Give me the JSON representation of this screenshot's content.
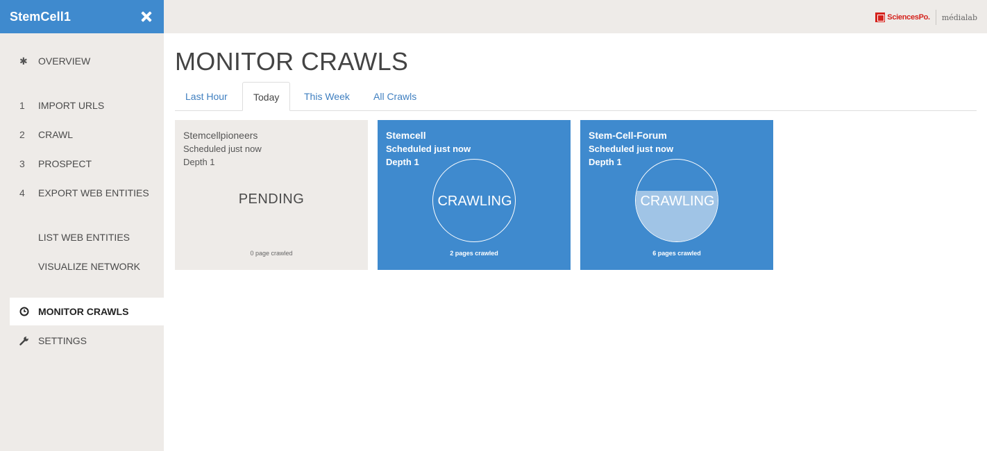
{
  "app": {
    "title": "StemCell1"
  },
  "sidebar": {
    "items": [
      {
        "lead": "✱",
        "label": "OVERVIEW"
      },
      {
        "lead": "1",
        "label": "IMPORT URLS"
      },
      {
        "lead": "2",
        "label": "CRAWL"
      },
      {
        "lead": "3",
        "label": "PROSPECT"
      },
      {
        "lead": "4",
        "label": "EXPORT WEB ENTITIES"
      },
      {
        "lead": "",
        "label": "LIST WEB ENTITIES"
      },
      {
        "lead": "",
        "label": "VISUALIZE NETWORK"
      },
      {
        "lead": "clock-icon",
        "label": "MONITOR CRAWLS"
      },
      {
        "lead": "wrench-icon",
        "label": "SETTINGS"
      }
    ]
  },
  "header": {
    "logo_left": "SciencesPo.",
    "logo_right": "médialab"
  },
  "main": {
    "title": "MONITOR CRAWLS",
    "tabs": [
      {
        "label": "Last Hour"
      },
      {
        "label": "Today"
      },
      {
        "label": "This Week"
      },
      {
        "label": "All Crawls"
      }
    ],
    "active_tab": "Today",
    "cards": [
      {
        "name": "Stemcellpioneers",
        "scheduled": "Scheduled just now",
        "depth": "Depth 1",
        "status": "PENDING",
        "pages": "0 page crawled",
        "progress": 0
      },
      {
        "name": "Stemcell",
        "scheduled": "Scheduled just now",
        "depth": "Depth 1",
        "status": "CRAWLING",
        "pages": "2 pages crawled",
        "progress": 0
      },
      {
        "name": "Stem-Cell-Forum",
        "scheduled": "Scheduled just now",
        "depth": "Depth 1",
        "status": "CRAWLING",
        "pages": "6 pages crawled",
        "progress": 0.62
      }
    ]
  },
  "colors": {
    "accent": "#3f8ace",
    "sidebar_bg": "#eeebe8",
    "link": "#3f7fc0",
    "fill": "#a0c4e6"
  }
}
